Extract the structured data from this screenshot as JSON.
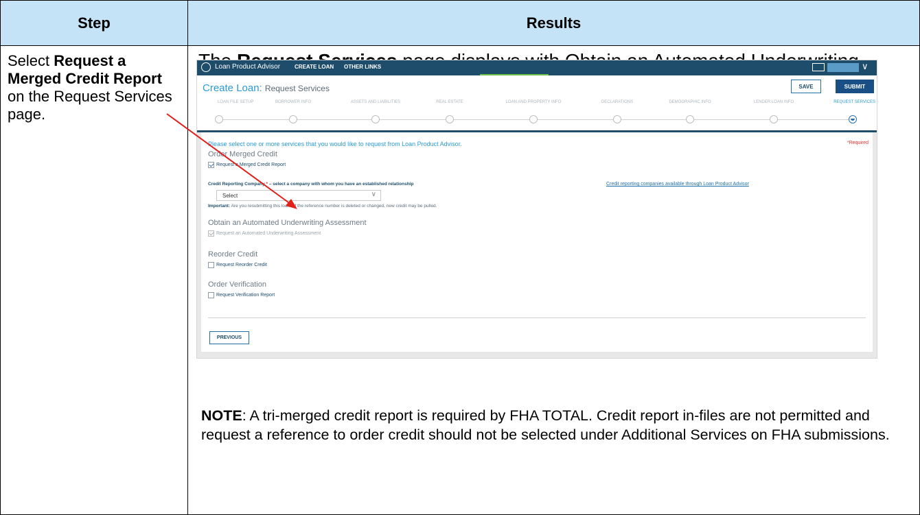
{
  "table": {
    "header_step": "Step",
    "header_results": "Results"
  },
  "step": {
    "pre": "Select ",
    "bold1": "Request a Merged Credit Report",
    "post": " on the Request Services page."
  },
  "results": {
    "title_pre": "The ",
    "title_bold": "Request Services",
    "title_post": " page displays with Obtain an Automated Underwriting Assessment selected:"
  },
  "note": {
    "label": "NOTE",
    "text": ": A tri-merged credit report is required by FHA TOTAL. Credit report in-files are not permitted and request a reference to order credit should not be selected under Additional Services on FHA submissions."
  },
  "screenshot": {
    "brand": "Loan Product Advisor",
    "nav": [
      "CREATE LOAN",
      "OTHER LINKS"
    ],
    "page_title": "Create Loan:",
    "page_subtitle": "Request Services",
    "save_label": "SAVE",
    "submit_label": "SUBMIT",
    "steps": [
      "LOAN FILE SETUP",
      "BORROWER INFO",
      "ASSETS AND LIABILITIES",
      "REAL ESTATE",
      "LOAN AND PROPERTY INFO",
      "DECLARATIONS",
      "DEMOGRAPHIC INFO",
      "LENDER LOAN INFO",
      "REQUEST SERVICES"
    ],
    "intro": "Please select one or more services that you would like to request from Loan Product Advisor.",
    "required": "*Required",
    "sections": {
      "merged": "Order Merged Credit",
      "merged_cb": "Request a Merged Credit Report",
      "cr_label": "Credit Reporting Company",
      "cr_star": "*",
      "cr_hint": "– select a company with whom you have an established relationship",
      "cr_link": "Credit reporting companies available through Loan Product Advisor",
      "select_value": "Select",
      "important_label": "Important:",
      "important_text": " Are you resubmitting this loan? If the reference number is deleted or changed, new credit may be pulled.",
      "automated": "Obtain an Automated Underwriting Assessment",
      "automated_cb": "Request an Automated Underwriting Assessment",
      "reorder": "Reorder Credit",
      "reorder_cb": "Request Reorder Credit",
      "verification": "Order Verification",
      "verification_cb": "Request Verification Report"
    },
    "prev_label": "PREVIOUS"
  },
  "colors": {
    "header_bg": "#c5e3f6",
    "nav_bg": "#1e4c6b",
    "accent": "#2a9bd4",
    "arrow": "#e0201b"
  }
}
